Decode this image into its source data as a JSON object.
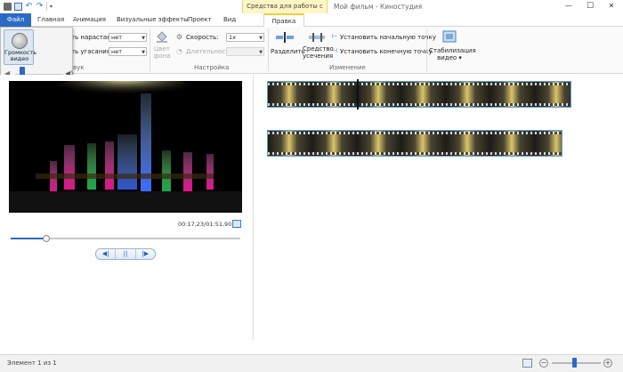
{
  "titlebar": {
    "context_group": "Средства для работы с видео",
    "window_title": "Мой фильм - Киностудия",
    "minimize_glyph": "—",
    "maximize_glyph": "☐",
    "close_glyph": "✕",
    "undo_glyph": "↶",
    "redo_glyph": "↷",
    "qat_dropdown_glyph": "▾"
  },
  "tabs": {
    "file": "Файл",
    "home": "Главная",
    "animation": "Анимация",
    "visual_effects": "Визуальные эффекты",
    "project": "Проект",
    "view": "Вид",
    "edit": "Правка"
  },
  "volume_popup": {
    "label": "Громкость видео",
    "level": 0.15,
    "speaker_glyph": "◀",
    "speaker_loud_glyph": "◀)"
  },
  "ribbon": {
    "fade_in_label": "Скорость нарастания:",
    "fade_in_value": "нет",
    "fade_out_label": "Скорость угасания:",
    "fade_out_value": "нет",
    "group_audio_partial": "вук",
    "bg_color_label": "Цвет фона",
    "speed_label": "Скорость:",
    "speed_value": "1x",
    "duration_label": "Длительность:",
    "duration_value": "",
    "group_settings": "Настройка",
    "split_label": "Разделить",
    "trim_tool_label": "Средство усечения",
    "set_start_label": "Установить начальную точку",
    "set_end_label": "Установить конечную точку",
    "group_editing": "Изменение",
    "stabilization_label": "Стабилизация видео",
    "stabilization_dd": "▾",
    "combo_dd": "▼"
  },
  "preview": {
    "timecode": "00:17,23/01:51,90",
    "seek_position": 0.155,
    "prev_frame": "◀|",
    "play_pause": "||",
    "next_frame": "|▶"
  },
  "status": {
    "text": "Элемент 1 из 1",
    "zoom_out": "−",
    "zoom_in": "+",
    "zoom_level": 0.45
  },
  "colors": {
    "accent": "#2b6bc4",
    "context_tab": "#fff6c4",
    "clip_border": "#5aa0d8"
  }
}
